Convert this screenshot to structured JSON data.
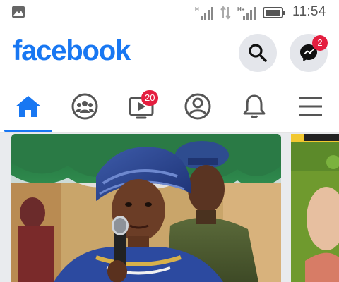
{
  "status_bar": {
    "time": "11:54",
    "signal_label": "H",
    "signal_label_2": "H+",
    "icons": [
      "gallery-icon",
      "signal-icon",
      "data-arrows-icon",
      "signal-icon",
      "battery-icon"
    ]
  },
  "header": {
    "logo": "facebook",
    "search_icon": "search-icon",
    "messenger_icon": "messenger-icon",
    "messenger_badge": "2"
  },
  "tabs": [
    {
      "name": "home",
      "icon": "home-icon",
      "active": true
    },
    {
      "name": "groups",
      "icon": "groups-icon"
    },
    {
      "name": "watch",
      "icon": "watch-icon",
      "badge": "20"
    },
    {
      "name": "profile",
      "icon": "profile-icon"
    },
    {
      "name": "notifications",
      "icon": "bell-icon"
    },
    {
      "name": "menu",
      "icon": "hamburger-icon"
    }
  ],
  "colors": {
    "brand": "#1877f2",
    "badge": "#e41e3f",
    "icon_gray": "#555555",
    "button_bg": "#e4e6eb"
  }
}
